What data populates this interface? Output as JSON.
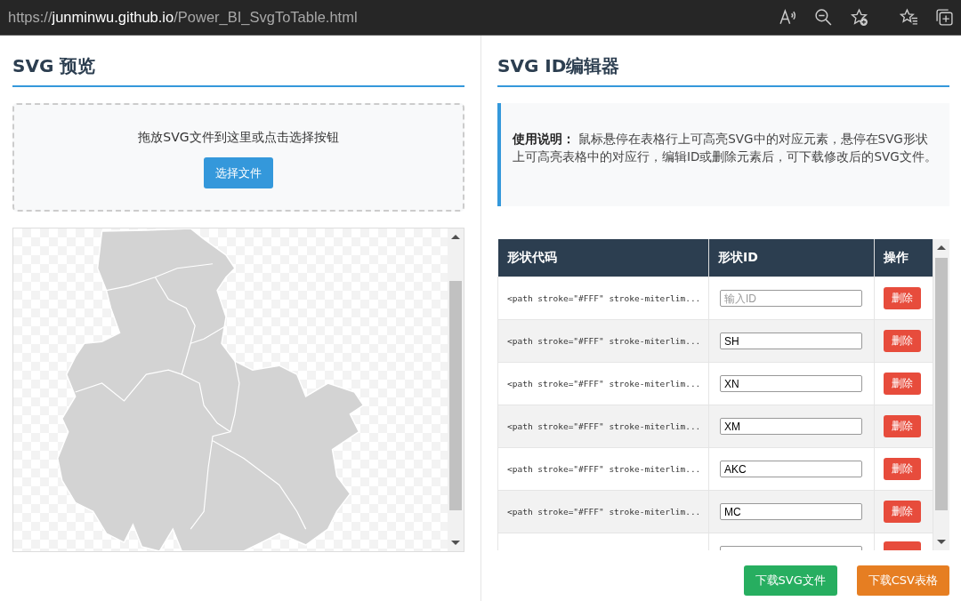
{
  "browser": {
    "url": "https://**junminwu.github.io**/Power_BI_SvgToTable.html"
  },
  "left": {
    "title": "SVG 预览",
    "dropzone": {
      "text": "拖放SVG文件到这里或点击选择按钮",
      "button": "选择文件"
    }
  },
  "right": {
    "title": "SVG ID编辑器",
    "info": "**使用说明：** 鼠标悬停在表格行上可高亮SVG中的对应元素，悬停在SVG形状上可高亮表格中的对应行，编辑ID或删除元素后，可下载修改后的SVG文件。",
    "table": {
      "columns": [
        "形状代码",
        "形状ID",
        "操作"
      ],
      "rows": [
        {
          "code": "<path stroke=\"#FFF\" stroke-miterlim...",
          "placeholder": "输入ID",
          "action": "删除"
        },
        {
          "code": "<path stroke=\"#FFF\" stroke-miterlim...",
          "value": "SH",
          "action": "删除"
        },
        {
          "code": "<path stroke=\"#FFF\" stroke-miterlim...",
          "value": "XN",
          "action": "删除"
        },
        {
          "code": "<path stroke=\"#FFF\" stroke-miterlim...",
          "value": "XM",
          "action": "删除"
        },
        {
          "code": "<path stroke=\"#FFF\" stroke-miterlim...",
          "value": "AKC",
          "action": "删除"
        },
        {
          "code": "<path stroke=\"#FFF\" stroke-miterlim...",
          "value": "MC",
          "action": "删除"
        },
        {}
      ]
    },
    "buttons": [
      {
        "label": "下载SVG文件",
        "kind": "svg"
      },
      {
        "label": "下载CSV表格",
        "kind": "csv"
      }
    ]
  }
}
